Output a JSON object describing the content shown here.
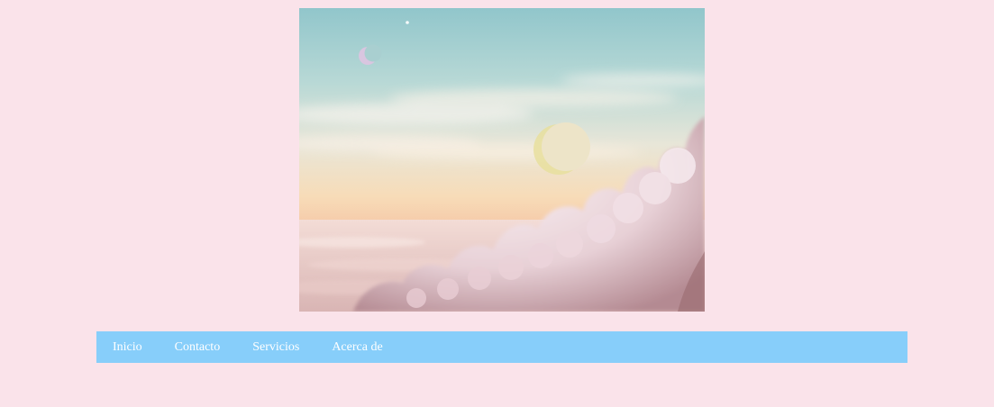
{
  "hero": {
    "image": "sky-clouds-moons-illustration"
  },
  "nav": {
    "items": [
      {
        "label": "Inicio"
      },
      {
        "label": "Contacto"
      },
      {
        "label": "Servicios"
      },
      {
        "label": "Acerca de"
      }
    ],
    "background_color": "#87cefa",
    "text_color": "#ffffff"
  },
  "page": {
    "background_color": "#fae3ea"
  }
}
